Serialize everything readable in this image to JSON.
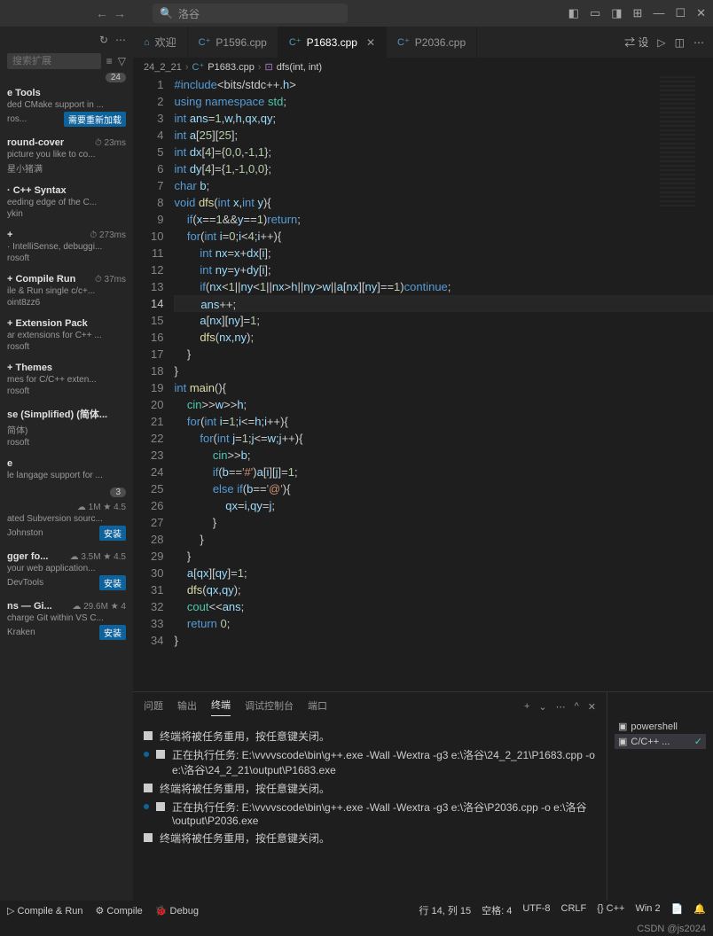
{
  "titlebar": {
    "search_text": "洛谷"
  },
  "extensions": {
    "search_placeholder": "搜索扩展",
    "count_badge": "24",
    "items": [
      {
        "title": "e Tools",
        "desc": "ded CMake support in ...",
        "author": "ros...",
        "btn": "需要重新加载",
        "meta": ""
      },
      {
        "title": "round-cover",
        "desc": "picture you like to co...",
        "author": "星小猪满",
        "btn": "",
        "meta": "⏱ 23ms"
      },
      {
        "title": "· C++ Syntax",
        "desc": "eeding edge of the C...",
        "author": "ykin",
        "btn": "",
        "meta": ""
      },
      {
        "title": "+",
        "desc": "· IntelliSense, debuggi...",
        "author": "rosoft",
        "btn": "",
        "meta": "⏱ 273ms"
      },
      {
        "title": "+ Compile Run",
        "desc": "ile & Run single c/c+...",
        "author": "oint8zz6",
        "btn": "",
        "meta": "⏱ 37ms"
      },
      {
        "title": "+ Extension Pack",
        "desc": "ar extensions for C++ ...",
        "author": "rosoft",
        "btn": "",
        "meta": ""
      },
      {
        "title": "+ Themes",
        "desc": "mes for C/C++ exten...",
        "author": "rosoft",
        "btn": "",
        "meta": ""
      },
      {
        "title": "se (Simplified) (简体...",
        "desc": "简体)",
        "author": "rosoft",
        "btn": "",
        "meta": ""
      },
      {
        "title": "e",
        "desc": "le langage support for ...",
        "author": "",
        "btn": "",
        "meta": ""
      },
      {
        "title": "",
        "desc": "ated Subversion sourc...",
        "author": "Johnston",
        "btn": "安装",
        "meta": "☁ 1M ★ 4.5"
      },
      {
        "title": "gger fo...",
        "desc": "your web application...",
        "author": "DevTools",
        "btn": "安装",
        "meta": "☁ 3.5M ★ 4.5"
      },
      {
        "title": "ns — Gi...",
        "desc": "charge Git within VS C...",
        "author": "Kraken",
        "btn": "安装",
        "meta": "☁ 29.6M ★ 4"
      }
    ],
    "small_badge": "3"
  },
  "tabs": [
    {
      "label": "欢迎",
      "icon": "⌂",
      "active": false,
      "closable": false
    },
    {
      "label": "P1596.cpp",
      "icon": "C⁺",
      "active": false,
      "closable": false
    },
    {
      "label": "P1683.cpp",
      "icon": "C⁺",
      "active": true,
      "closable": true
    },
    {
      "label": "P2036.cpp",
      "icon": "C⁺",
      "active": false,
      "closable": false
    }
  ],
  "tab_actions_text": "⇄ 设",
  "breadcrumb": {
    "folder": "24_2_21",
    "file": "P1683.cpp",
    "symbol": "dfs(int, int)"
  },
  "code_lines": [
    "#include<bits/stdc++.h>",
    "using namespace std;",
    "int ans=1,w,h,qx,qy;",
    "int a[25][25];",
    "int dx[4]={0,0,-1,1};",
    "int dy[4]={1,-1,0,0};",
    "char b;",
    "void dfs(int x,int y){",
    "    if(x==1&&y==1)return;",
    "    for(int i=0;i<4;i++){",
    "        int nx=x+dx[i];",
    "        int ny=y+dy[i];",
    "        if(nx<1||ny<1||nx>h||ny>w||a[nx][ny]==1)continue;",
    "        ans++;",
    "        a[nx][ny]=1;",
    "        dfs(nx,ny);",
    "    }",
    "}",
    "int main(){",
    "    cin>>w>>h;",
    "    for(int i=1;i<=h;i++){",
    "        for(int j=1;j<=w;j++){",
    "            cin>>b;",
    "            if(b=='#')a[i][j]=1;",
    "            else if(b=='@'){",
    "                qx=i,qy=j;",
    "            }",
    "        }",
    "    }",
    "    a[qx][qy]=1;",
    "    dfs(qx,qy);",
    "    cout<<ans;",
    "    return 0;",
    "}"
  ],
  "current_line": 14,
  "terminal": {
    "tabs": [
      "问题",
      "输出",
      "终端",
      "调试控制台",
      "端口"
    ],
    "active_tab": "终端",
    "sessions": [
      {
        "label": "powershell",
        "icon": "▣"
      },
      {
        "label": "C/C++ ...",
        "icon": "▣",
        "active": true,
        "check": true
      }
    ],
    "lines": [
      {
        "kind": "sq",
        "text": "终端将被任务重用，按任意键关闭。"
      },
      {
        "kind": "dot",
        "text": "正在执行任务: E:\\vvvvscode\\bin\\g++.exe -Wall -Wextra -g3 e:\\洛谷\\24_2_21\\P1683.cpp -o e:\\洛谷\\24_2_21\\output\\P1683.exe"
      },
      {
        "kind": "sq",
        "text": "终端将被任务重用，按任意键关闭。"
      },
      {
        "kind": "dot",
        "text": "正在执行任务: E:\\vvvvscode\\bin\\g++.exe -Wall -Wextra -g3 e:\\洛谷\\P2036.cpp -o e:\\洛谷\\output\\P2036.exe"
      },
      {
        "kind": "sq",
        "text": "终端将被任务重用，按任意键关闭。"
      }
    ]
  },
  "statusbar": {
    "left": [
      "▷ Compile & Run",
      "⚙ Compile",
      "🐞 Debug"
    ],
    "right": [
      "行 14, 列 15",
      "空格: 4",
      "UTF-8",
      "CRLF",
      "{} C++",
      "Win 2",
      "📄",
      "🔔"
    ]
  },
  "watermark": "CSDN @js2024"
}
